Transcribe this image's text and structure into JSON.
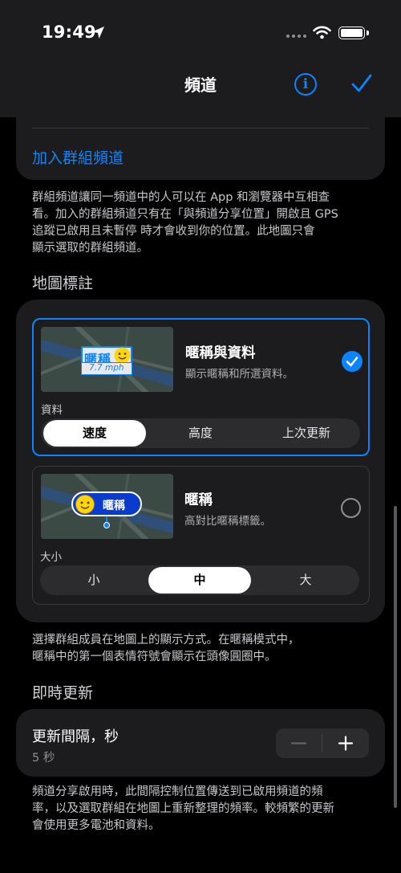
{
  "status_bar": {
    "time": "19:49"
  },
  "nav": {
    "title": "頻道",
    "info_icon": "info-circle-icon",
    "done_icon": "checkmark-icon"
  },
  "group_card": {
    "add_group_link": "加入群組頻道"
  },
  "group_footnote": [
    "群組頻道讓同一頻道中的人可以在 App 和瀏覽器中互相查",
    "看。加入的群組頻道只有在「與頻道分享位置」開啟且 GPS",
    "追蹤已啟用且未暫停 時才會收到你的位置。此地圖只會",
    "顯示選取的群組頻道。"
  ],
  "map_labels_section": {
    "header": "地圖標註",
    "options": [
      {
        "title": "暱稱與資料",
        "subtitle": "顯示暱稱和所選資料。",
        "selected": true,
        "preview_nickname": "暱稱",
        "preview_speed": "7.7 mph",
        "sub_label": "資料",
        "segments": [
          "速度",
          "高度",
          "上次更新"
        ],
        "selected_segment": "速度"
      },
      {
        "title": "暱稱",
        "subtitle": "高對比暱稱標籤。",
        "selected": false,
        "preview_nickname": "暱稱",
        "sub_label": "大小",
        "segments": [
          "小",
          "中",
          "大"
        ],
        "selected_segment": "中"
      }
    ],
    "footnote": [
      "選擇群組成員在地圖上的顯示方式。在暱稱模式中，",
      "暱稱中的第一個表情符號會顯示在頭像圓圈中。"
    ]
  },
  "live_update_section": {
    "header": "即時更新",
    "interval_title": "更新間隔，秒",
    "interval_value": "5 秒",
    "footnote": [
      "頻道分享啟用時，此間隔控制位置傳送到已啟用頻道的頻",
      "率，以及選取群組在地圖上重新整理的頻率。較頻繁的更新",
      "會使用更多電池和資料。"
    ]
  },
  "colors": {
    "accent": "#0a84ff",
    "background": "#000000",
    "card": "#1c1c1e"
  }
}
